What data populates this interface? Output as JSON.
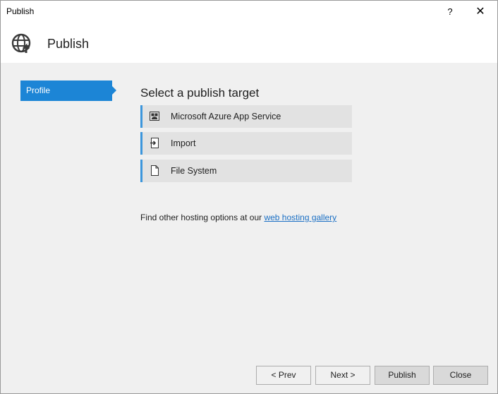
{
  "window": {
    "title": "Publish",
    "help_label": "?",
    "close_glyph": "✕"
  },
  "header": {
    "title": "Publish",
    "icon": "globe-publish-icon"
  },
  "sidebar": {
    "items": [
      {
        "label": "Profile",
        "selected": true
      }
    ]
  },
  "main": {
    "section_title": "Select a publish target",
    "targets": [
      {
        "label": "Microsoft Azure App Service",
        "icon": "azure-app-service-icon"
      },
      {
        "label": "Import",
        "icon": "import-icon"
      },
      {
        "label": "File System",
        "icon": "file-icon"
      }
    ],
    "hosting_text": "Find other hosting options at our ",
    "hosting_link": "web hosting gallery"
  },
  "footer": {
    "prev_label": "< Prev",
    "next_label": "Next >",
    "publish_label": "Publish",
    "close_label": "Close"
  },
  "colors": {
    "accent": "#1c85d6",
    "target_bar": "#3c96dc",
    "link": "#1a6fc4"
  }
}
